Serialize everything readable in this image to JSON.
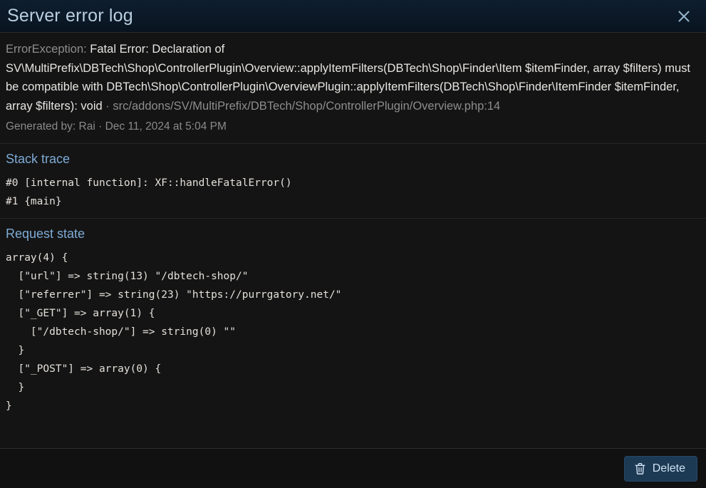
{
  "header": {
    "title": "Server error log",
    "close_icon": "close-icon",
    "close_label": "✕"
  },
  "error": {
    "exception_type": "ErrorException:",
    "message": " Fatal Error: Declaration of SV\\MultiPrefix\\DBTech\\Shop\\ControllerPlugin\\Overview::applyItemFilters(DBTech\\Shop\\Finder\\Item $itemFinder, array $filters) must be compatible with DBTech\\Shop\\ControllerPlugin\\OverviewPlugin::applyItemFilters(DBTech\\Shop\\Finder\\ItemFinder $itemFinder, array $filters): void",
    "separator": " · ",
    "file": "src/addons/SV/MultiPrefix/DBTech/Shop/ControllerPlugin/Overview.php:14",
    "generated_by": "Generated by: Rai · Dec 11, 2024 at 5:04 PM"
  },
  "stack_trace": {
    "title": "Stack trace",
    "content": "#0 [internal function]: XF::handleFatalError()\n#1 {main}"
  },
  "request_state": {
    "title": "Request state",
    "content": "array(4) {\n  [\"url\"] => string(13) \"/dbtech-shop/\"\n  [\"referrer\"] => string(23) \"https://purrgatory.net/\"\n  [\"_GET\"] => array(1) {\n    [\"/dbtech-shop/\"] => string(0) \"\"\n  }\n  [\"_POST\"] => array(0) {\n  }\n}"
  },
  "footer": {
    "delete_label": "Delete",
    "delete_icon": "trash-icon"
  },
  "colors": {
    "header_bg": "#0b1826",
    "body_bg": "#141414",
    "title_text": "#b9cfe0",
    "section_heading": "#7eabd6",
    "code_text": "#e4e0db",
    "muted_text": "#8a8a8a",
    "delete_button_bg": "#1d3a55",
    "delete_button_text": "#cfe2f2"
  }
}
